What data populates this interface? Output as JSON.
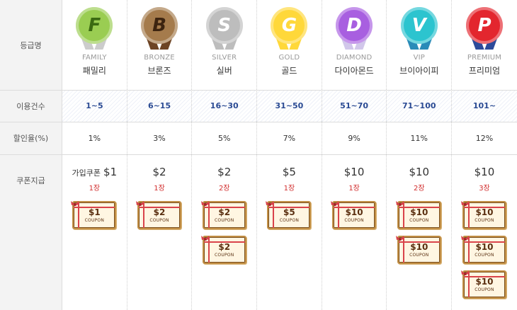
{
  "labels": {
    "grade": "등급명",
    "count": "이용건수",
    "discount": "할인율(%)",
    "coupon": "쿠폰지급"
  },
  "grades": [
    {
      "en": "FAMILY",
      "ko": "패밀리",
      "letter": "F",
      "color": "#9acd52",
      "letterColor": "#3b6a12",
      "ribbon": "#cccccc",
      "icon": "family-medal-icon",
      "count": "1~5",
      "discount": "1%",
      "prefix": "가입쿠폰",
      "amount": "$1",
      "qty": "1장",
      "coupons": [
        "$1"
      ]
    },
    {
      "en": "BRONZE",
      "ko": "브론즈",
      "letter": "B",
      "color": "#a57b4c",
      "letterColor": "#3d2410",
      "ribbon": "#6d4424",
      "icon": "bronze-medal-icon",
      "count": "6~15",
      "discount": "3%",
      "prefix": "",
      "amount": "$2",
      "qty": "1장",
      "coupons": [
        "$2"
      ]
    },
    {
      "en": "SILVER",
      "ko": "실버",
      "letter": "S",
      "color": "#bdbdbd",
      "letterColor": "#ffffff",
      "ribbon": "#bdbdbd",
      "icon": "silver-medal-icon",
      "count": "16~30",
      "discount": "5%",
      "prefix": "",
      "amount": "$2",
      "qty": "2장",
      "coupons": [
        "$2",
        "$2"
      ]
    },
    {
      "en": "GOLD",
      "ko": "골드",
      "letter": "G",
      "color": "#ffd83a",
      "letterColor": "#ffffff",
      "ribbon": "#ffd83a",
      "icon": "gold-medal-icon",
      "count": "31~50",
      "discount": "7%",
      "prefix": "",
      "amount": "$5",
      "qty": "1장",
      "coupons": [
        "$5"
      ]
    },
    {
      "en": "DIAMOND",
      "ko": "다이아몬드",
      "letter": "D",
      "color": "#a85fe0",
      "letterColor": "#ffffff",
      "ribbon": "#d1c7ea",
      "icon": "diamond-medal-icon",
      "count": "51~70",
      "discount": "9%",
      "prefix": "",
      "amount": "$10",
      "qty": "1장",
      "coupons": [
        "$10"
      ]
    },
    {
      "en": "VIP",
      "ko": "브이아이피",
      "letter": "V",
      "color": "#2cc4cf",
      "letterColor": "#ffffff",
      "ribbon": "#2a8bb8",
      "icon": "vip-medal-icon",
      "count": "71~100",
      "discount": "11%",
      "prefix": "",
      "amount": "$10",
      "qty": "2장",
      "coupons": [
        "$10",
        "$10"
      ]
    },
    {
      "en": "PREMIUM",
      "ko": "프리미엄",
      "letter": "P",
      "color": "#e3262e",
      "letterColor": "#ffffff",
      "ribbon": "#2c4a9a",
      "icon": "premium-medal-icon",
      "count": "101~",
      "discount": "12%",
      "prefix": "",
      "amount": "$10",
      "qty": "3장",
      "coupons": [
        "$10",
        "$10",
        "$10"
      ]
    }
  ],
  "coupon_word": "COUPON"
}
